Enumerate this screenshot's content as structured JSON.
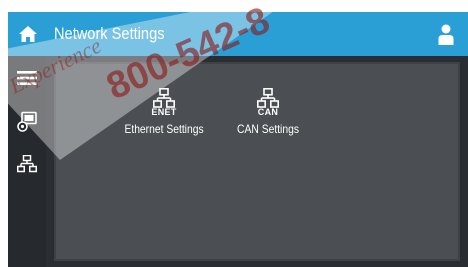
{
  "header": {
    "title": "Network Settings",
    "home_icon": "home-icon",
    "user_icon": "user-icon"
  },
  "sidebar": {
    "items": [
      {
        "name": "menu",
        "icon": "hamburger-menu-icon"
      },
      {
        "name": "display",
        "icon": "display-settings-icon"
      },
      {
        "name": "network",
        "icon": "network-icon"
      }
    ]
  },
  "tiles": [
    {
      "tag": "ENET",
      "label": "Ethernet Settings",
      "icon": "network-icon"
    },
    {
      "tag": "CAN",
      "label": "CAN Settings",
      "icon": "network-icon"
    }
  ],
  "watermark": {
    "line1": "800-542-8",
    "line2": "Experience"
  },
  "colors": {
    "header": "#2a9fd6",
    "screen_bg": "#2a2d31",
    "content_bg": "#4b4f53",
    "text": "#ffffff",
    "watermark": "#8a1a1a"
  }
}
